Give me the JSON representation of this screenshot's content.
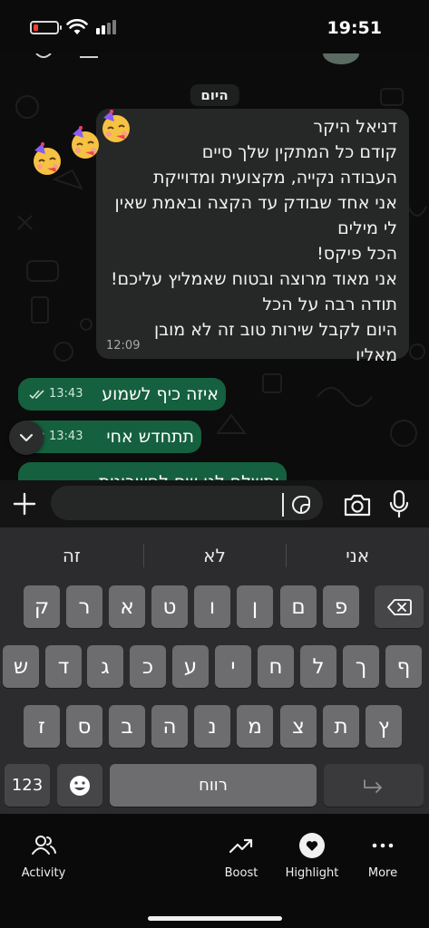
{
  "status_bar": {
    "time": "19:51",
    "battery_level_percent": 20,
    "battery_color": "#ff3b30",
    "icons": [
      "battery-icon",
      "wifi-icon",
      "cellular-signal-icon"
    ]
  },
  "chat": {
    "day_label": "היום",
    "incoming_message": {
      "lines": [
        "דניאל היקר",
        "קודם כל המתקין שלך סיים",
        "העבודה נקייה, מקצועית ומדוייקת",
        "אני אחד שבודק עד הקצה ובאמת שאין",
        "לי מילים",
        "הכל פיקס!",
        "אני מאוד מרוצה ובטוח שאמליץ עליכם!",
        "תודה רבה על הכל",
        "היום לקבל שירות טוב זה לא מובן",
        "מאליו"
      ],
      "time": "12:09",
      "reactions": [
        "partying-face-icon",
        "partying-face-icon",
        "partying-face-icon"
      ]
    },
    "outgoing_messages": [
      {
        "text": "איזה כיף לשמוע",
        "time": "13:43",
        "status": "read"
      },
      {
        "text": "תתחדש אחי",
        "time": "13:43",
        "status": "read"
      },
      {
        "text": "ותשלח לנו שם לחשבונית",
        "time": "",
        "status": ""
      }
    ],
    "colors": {
      "outgoing": "#15603e",
      "incoming": "#262828",
      "background": "#0c0c0c"
    }
  },
  "input_bar": {
    "placeholder": "",
    "value": ""
  },
  "keyboard": {
    "suggestions": [
      "זה",
      "לא",
      "אני"
    ],
    "row1": [
      "ק",
      "ר",
      "א",
      "ט",
      "ו",
      "ן",
      "ם",
      "פ"
    ],
    "row2": [
      "ש",
      "ד",
      "ג",
      "כ",
      "ע",
      "י",
      "ח",
      "ל",
      "ך",
      "ף"
    ],
    "row3": [
      "ז",
      "ס",
      "ב",
      "ה",
      "נ",
      "מ",
      "צ",
      "ת",
      "ץ"
    ],
    "numbers_label": "123",
    "space_label": "רווח"
  },
  "bottom_nav": {
    "items": [
      {
        "label": "Activity",
        "icon": "people-icon"
      },
      {
        "label": "Boost",
        "icon": "trending-up-icon"
      },
      {
        "label": "Highlight",
        "icon": "heart-icon"
      },
      {
        "label": "More",
        "icon": "more-dots-icon"
      }
    ]
  }
}
